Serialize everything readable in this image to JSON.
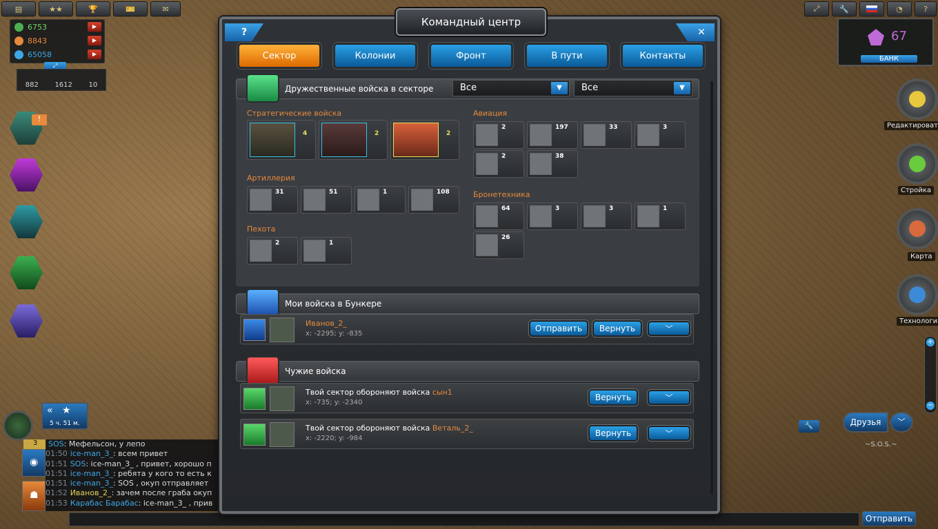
{
  "resources": {
    "items": [
      {
        "value": "6753",
        "color": "#6fd66b"
      },
      {
        "value": "8843",
        "color": "#e8893c"
      },
      {
        "value": "65058",
        "color": "#3fa7e6"
      }
    ],
    "population": [
      "882",
      "1612",
      "10"
    ]
  },
  "bank": {
    "crystals": "67",
    "label": "БАНК"
  },
  "right_menu": [
    {
      "label": "Редактировать"
    },
    {
      "label": "Стройка"
    },
    {
      "label": "Карта"
    },
    {
      "label": "Технологии"
    }
  ],
  "left_badge": "!",
  "timer": "5 ч. 51 м.",
  "chat_badge": "3",
  "window": {
    "title": "Командный центр",
    "help": "?",
    "close": "✕",
    "tabs": [
      {
        "label": "Сектор"
      },
      {
        "label": "Колонии"
      },
      {
        "label": "Фронт"
      },
      {
        "label": "В пути"
      },
      {
        "label": "Контакты"
      }
    ],
    "friendly": {
      "header": "Дружественные войска в секторе",
      "filter1": "Все",
      "filter2": "Все",
      "strategic": {
        "label": "Стратегические войска",
        "counts": [
          "4",
          "2",
          "2"
        ]
      },
      "artillery": {
        "label": "Артиллерия",
        "counts": [
          "31",
          "51",
          "1",
          "108"
        ]
      },
      "infantry": {
        "label": "Пехота",
        "counts": [
          "2",
          "1"
        ]
      },
      "aviation": {
        "label": "Авиация",
        "counts": [
          "2",
          "197",
          "33",
          "3",
          "2",
          "38"
        ]
      },
      "armor": {
        "label": "Бронетехника",
        "counts": [
          "64",
          "3",
          "3",
          "1",
          "26"
        ]
      }
    },
    "bunker": {
      "header": "Мои войска в Бункере",
      "row": {
        "name": "Иванов_2_",
        "coords": "x: -2295; y: -835",
        "send": "Отправить",
        "return": "Вернуть"
      }
    },
    "foreign": {
      "header": "Чужие войска",
      "rows": [
        {
          "prefix": "Твой сектор обороняют войска ",
          "name": "сын1",
          "coords": "x: -735; y: -2340",
          "return": "Вернуть"
        },
        {
          "prefix": "Твой сектор обороняют войска ",
          "name": "Веталь_2_",
          "coords": "x: -2220; y: -984",
          "return": "Вернуть"
        }
      ]
    }
  },
  "friends_btn": "Друзья",
  "sos_label": "~S.O.S.~",
  "send_btn": "Отправить",
  "chat": [
    {
      "time": "",
      "name": "SOS",
      "text": ": Мефельсон, у лепо"
    },
    {
      "time": "01:50",
      "name": "ice-man_3_",
      "text": ": всем привет"
    },
    {
      "time": "01:51",
      "name": "SOS",
      "text": ": ice-man_3_ , привет, хорошо п"
    },
    {
      "time": "01:51",
      "name": "ice-man_3_",
      "text": ": ребята у кого то есть к"
    },
    {
      "time": "01:51",
      "name": "ice-man_3_",
      "text": ": SOS , окуп отправляет"
    },
    {
      "time": "01:52",
      "name": "Иванов_2_",
      "text": ": зачем после граба окуп"
    },
    {
      "time": "01:53",
      "name": "Карабас Барабас",
      "text": ": ice-man_3_ , прив"
    }
  ]
}
